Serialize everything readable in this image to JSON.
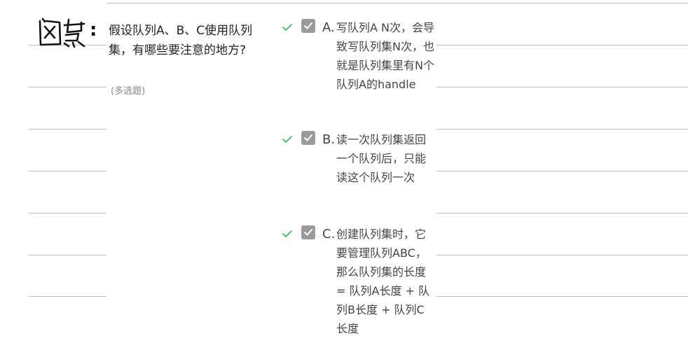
{
  "question": {
    "stamp_text": "问题",
    "colon": ":",
    "text": "假设队列A、B、C使用队列集，有哪些要注意的地方?",
    "type_label": "(多选题)"
  },
  "options": [
    {
      "letter": "A.",
      "text": "写队列A N次，会导致写队列集N次，也就是队列集里有N个队列A的handle",
      "checked": true,
      "correct": true
    },
    {
      "letter": "B.",
      "text": "读一次队列集返回一个队列后，只能读这个队列一次",
      "checked": true,
      "correct": true
    },
    {
      "letter": "C.",
      "text": "创建队列集时，它要管理队列ABC，那么队列集的长度 = 队列A长度 + 队列B长度 + 队列C长度",
      "checked": true,
      "correct": true
    }
  ],
  "colors": {
    "correct_check": "#3cb44b",
    "checkbox_fill": "#9a9a9a",
    "rule": "#bdbdbd"
  }
}
